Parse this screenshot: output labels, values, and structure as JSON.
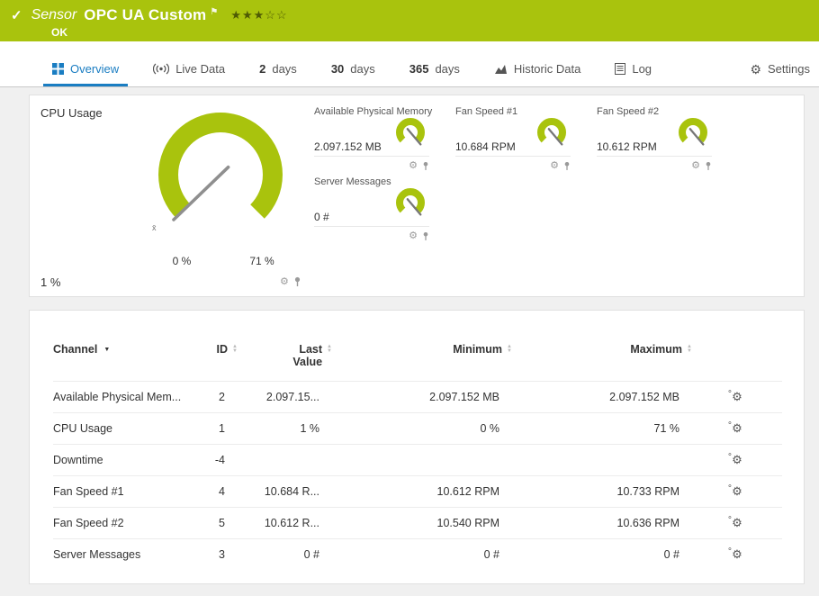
{
  "colors": {
    "green": "#a9c30d",
    "blue": "#1a7dc2"
  },
  "icons": {
    "check": "✓",
    "flag": "⚑",
    "gear": "⚙",
    "sort_up": "▲",
    "sort_down": "▼",
    "caret_down": "▼",
    "avg_marker": "x̄"
  },
  "header": {
    "kind": "Sensor",
    "title": "OPC UA Custom",
    "stars": "★★★☆☆",
    "status": "OK"
  },
  "tabs": [
    {
      "label": "Overview"
    },
    {
      "label": "Live Data"
    },
    {
      "num": "2",
      "label": "days"
    },
    {
      "num": "30",
      "label": "days"
    },
    {
      "num": "365",
      "label": "days"
    },
    {
      "label": "Historic Data"
    },
    {
      "label": "Log"
    },
    {
      "label": "Settings"
    }
  ],
  "gauges": {
    "cpu": {
      "title": "CPU Usage",
      "value": "1 %",
      "scale_min": "0 %",
      "scale_max": "71 %"
    },
    "minis": [
      {
        "title": "Available Physical Memory",
        "value": "2.097.152 MB"
      },
      {
        "title": "Fan Speed #1",
        "value": "10.684 RPM"
      },
      {
        "title": "Fan Speed #2",
        "value": "10.612 RPM"
      },
      {
        "title": "Server Messages",
        "value": "0 #"
      }
    ]
  },
  "table": {
    "columns": [
      "Channel",
      "ID",
      "Last Value",
      "Minimum",
      "Maximum"
    ],
    "rows": [
      {
        "channel": "Available Physical Mem...",
        "id": "2",
        "last": "2.097.15...",
        "min": "2.097.152 MB",
        "max": "2.097.152 MB"
      },
      {
        "channel": "CPU Usage",
        "id": "1",
        "last": "1 %",
        "min": "0 %",
        "max": "71 %"
      },
      {
        "channel": "Downtime",
        "id": "-4",
        "last": "",
        "min": "",
        "max": ""
      },
      {
        "channel": "Fan Speed #1",
        "id": "4",
        "last": "10.684 R...",
        "min": "10.612 RPM",
        "max": "10.733 RPM"
      },
      {
        "channel": "Fan Speed #2",
        "id": "5",
        "last": "10.612 R...",
        "min": "10.540 RPM",
        "max": "10.636 RPM"
      },
      {
        "channel": "Server Messages",
        "id": "3",
        "last": "0 #",
        "min": "0 #",
        "max": "0 #"
      }
    ]
  }
}
